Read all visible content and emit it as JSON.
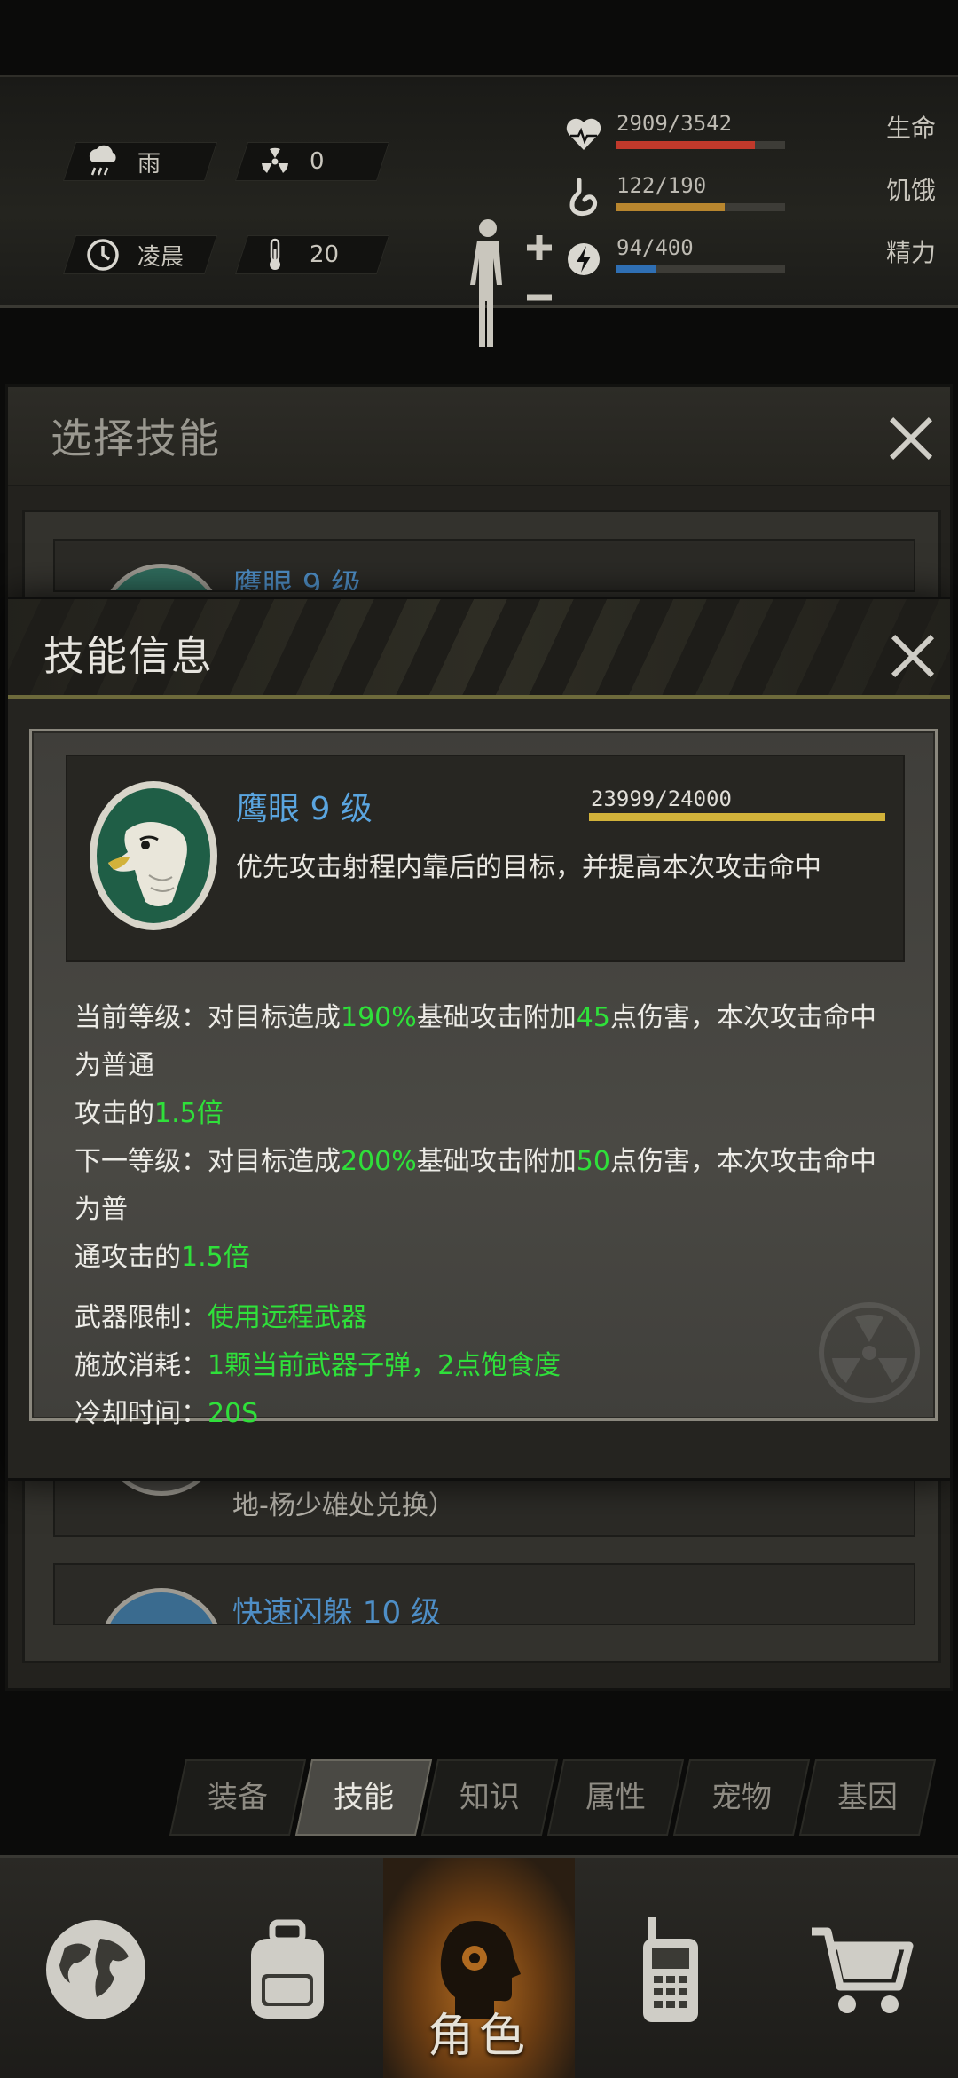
{
  "hud": {
    "weather": "雨",
    "radiation": "0",
    "time_of_day": "凌晨",
    "temperature": "20",
    "stats": [
      {
        "icon": "heart-icon",
        "value": "2909/3542",
        "label": "生命",
        "ratio": 0.821,
        "color": "#c0392b"
      },
      {
        "icon": "stomach-icon",
        "value": "122/190",
        "label": "饥饿",
        "ratio": 0.642,
        "color": "#b8862e"
      },
      {
        "icon": "energy-icon",
        "value": "94/400",
        "label": "精力",
        "ratio": 0.235,
        "color": "#2f6fb4"
      }
    ]
  },
  "select_dialog": {
    "title": "选择技能",
    "items": [
      {
        "name": "鹰眼 9 级",
        "desc": ""
      },
      {
        "name": "",
        "desc": "地-杨少雄处兑换）"
      },
      {
        "name": "快速闪躲 10 级",
        "desc": ""
      }
    ]
  },
  "info_dialog": {
    "title": "技能信息",
    "skill": {
      "name": "鹰眼 9 级",
      "xp": "23999/24000",
      "xp_ratio": 0.99996,
      "desc": "优先攻击射程内靠后的目标，并提高本次攻击命中"
    },
    "current": {
      "label": "当前等级：",
      "t1": "对目标造成",
      "pct": "190%",
      "t2": "基础攻击附加",
      "dmg": "45",
      "t3": "点伤害，本次攻击命中为普通",
      "t4": "攻击的",
      "mult": "1.5倍"
    },
    "next": {
      "label": "下一等级：",
      "t1": "对目标造成",
      "pct": "200%",
      "t2": "基础攻击附加",
      "dmg": "50",
      "t3": "点伤害，本次攻击命中为普",
      "t4": "通攻击的",
      "mult": "1.5倍"
    },
    "weapon_label": "武器限制：",
    "weapon_value": "使用远程武器",
    "cost_label": "施放消耗：",
    "cost_value": "1颗当前武器子弹，2点饱食度",
    "cooldown_label": "冷却时间：",
    "cooldown_value": "20S"
  },
  "tabs": [
    "装备",
    "技能",
    "知识",
    "属性",
    "宠物",
    "基因"
  ],
  "active_tab": 1,
  "nav": {
    "active_label": "角色"
  }
}
